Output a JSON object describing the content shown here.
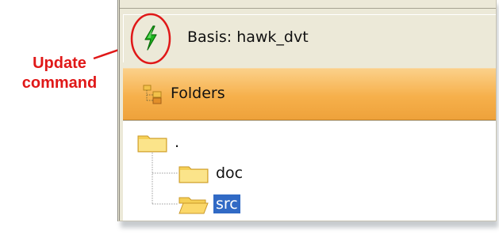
{
  "annotation": {
    "line1": "Update",
    "line2": "command",
    "color": "#e01818"
  },
  "toolbar": {
    "update_icon": "lightning-bolt-icon",
    "basis_label": "Basis: hawk_dvt"
  },
  "folders_panel": {
    "icon": "folder-tree-icon",
    "title": "Folders",
    "header_color": "#f6b04b"
  },
  "tree": {
    "root": {
      "label": "."
    },
    "children": [
      {
        "label": "doc",
        "selected": false
      },
      {
        "label": "src",
        "selected": true
      }
    ]
  },
  "colors": {
    "selection": "#316ac5",
    "bolt": "#1eb51e",
    "folder": "#f5cf55"
  }
}
